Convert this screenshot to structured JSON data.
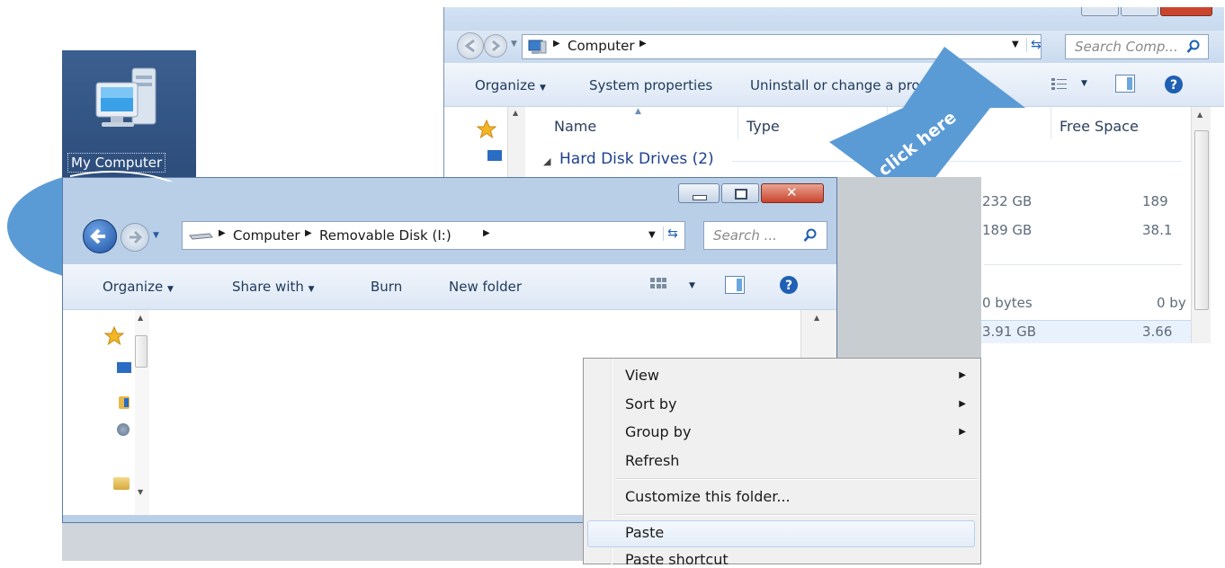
{
  "desktop": {
    "my_computer_label": "My Computer"
  },
  "back_window": {
    "address_crumbs": [
      "Computer"
    ],
    "search_placeholder": "Search Comp...",
    "toolbar": {
      "organize": "Organize",
      "system_properties": "System properties",
      "uninstall": "Uninstall or change a pro"
    },
    "columns": {
      "name": "Name",
      "type": "Type",
      "free_space": "Free Space"
    },
    "group_header": "Hard Disk Drives (2)",
    "rows": [
      {
        "total": "232 GB",
        "free": "189"
      },
      {
        "total": "189 GB",
        "free": "38.1"
      },
      {
        "total": "0 bytes",
        "free": "0 by"
      },
      {
        "total": "3.91 GB",
        "free": "3.66"
      }
    ]
  },
  "callout": {
    "text": "click here"
  },
  "front_window": {
    "address_crumbs": [
      "Computer",
      "Removable Disk (I:)"
    ],
    "search_placeholder": "Search ...",
    "toolbar": {
      "organize": "Organize",
      "share_with": "Share with",
      "burn": "Burn",
      "new_folder": "New folder"
    }
  },
  "context_menu": {
    "items": [
      "View",
      "Sort by",
      "Group by",
      "Refresh",
      "Customize this folder...",
      "Paste",
      "Paste shortcut"
    ]
  },
  "colors": {
    "accent": "#5b9bd5",
    "window_chrome": "#c9daef",
    "close_red": "#c9452f",
    "link_blue": "#1e5eb5"
  }
}
